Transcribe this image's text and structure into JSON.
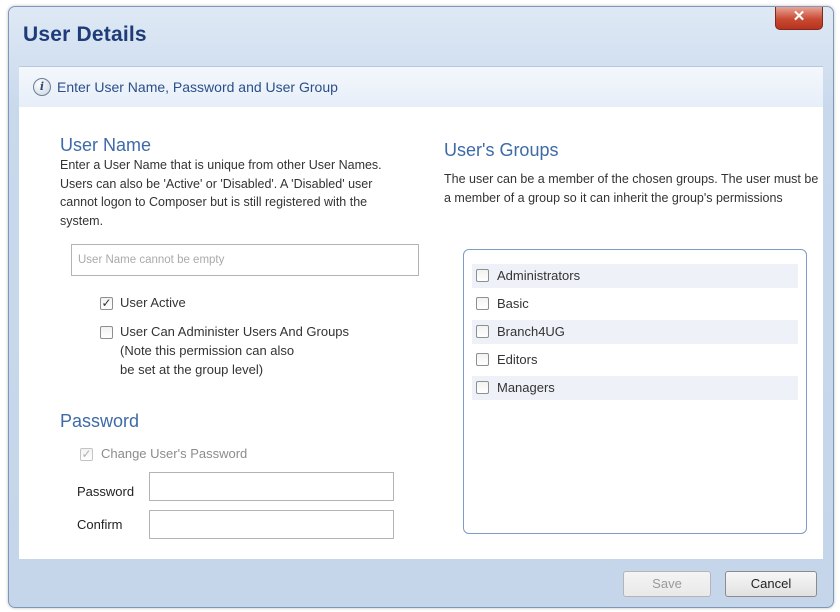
{
  "window": {
    "title": "User Details",
    "close_label": "✕"
  },
  "info_bar": {
    "icon": "info-icon",
    "icon_glyph": "i",
    "text": "Enter User Name, Password and User Group"
  },
  "user_name": {
    "heading": "User Name",
    "description": "Enter a User Name that is unique from other User Names. Users can also be 'Active' or 'Disabled'. A 'Disabled' user cannot logon to Composer but is still registered with the system.",
    "input_value": "",
    "input_placeholder": "User Name cannot be empty",
    "user_active_label": "User Active",
    "user_active_checked": true,
    "can_administer_label": "User Can Administer Users And Groups",
    "can_administer_note": "(Note this permission can also be set at the group level)",
    "can_administer_checked": false
  },
  "password": {
    "heading": "Password",
    "change_password_label": "Change User's Password",
    "change_password_checked": true,
    "password_label": "Password",
    "password_value": "",
    "confirm_label": "Confirm",
    "confirm_value": ""
  },
  "groups": {
    "heading": "User's Groups",
    "description": "The user can be a member of the chosen groups. The user must be a member of a group so it can inherit the group's permissions",
    "items": [
      {
        "label": "Administrators",
        "checked": false
      },
      {
        "label": "Basic",
        "checked": false
      },
      {
        "label": "Branch4UG",
        "checked": false
      },
      {
        "label": "Editors",
        "checked": false
      },
      {
        "label": "Managers",
        "checked": false
      }
    ]
  },
  "footer": {
    "save_label": "Save",
    "cancel_label": "Cancel"
  },
  "colors": {
    "title": "#1d3c78",
    "section_heading": "#3e6aa8",
    "close_button": "#c94a33",
    "group_box_border": "#7e9dc5"
  }
}
